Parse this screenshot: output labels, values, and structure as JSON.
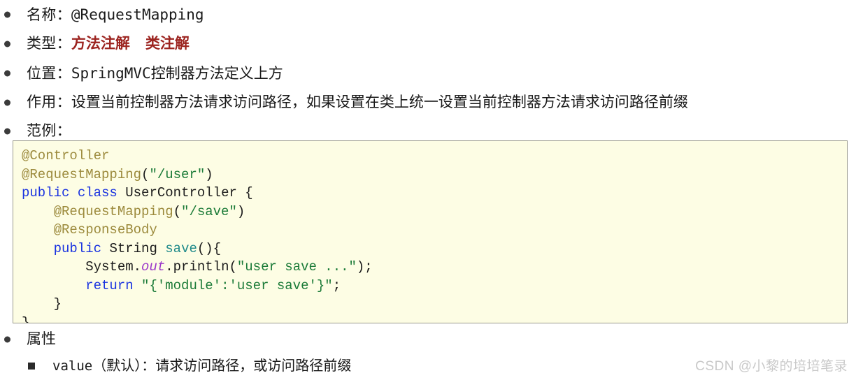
{
  "bullets": [
    {
      "label": "名称：",
      "value": "@RequestMapping",
      "style": "mono"
    },
    {
      "label": "类型：",
      "tags": [
        "方法注解",
        "类注解"
      ],
      "style": "tags"
    },
    {
      "label": "位置：",
      "value": "SpringMVC控制器方法定义上方",
      "style": "mixed"
    },
    {
      "label": "作用：",
      "value": "设置当前控制器方法请求访问路径，如果设置在类上统一设置当前控制器方法请求访问路径前缀",
      "style": "text"
    },
    {
      "label": "范例：",
      "value": "",
      "style": "text"
    }
  ],
  "code": {
    "lines": [
      [
        {
          "t": "@Controller",
          "c": "ann"
        }
      ],
      [
        {
          "t": "@RequestMapping",
          "c": "ann"
        },
        {
          "t": "(",
          "c": "plain"
        },
        {
          "t": "\"/user\"",
          "c": "str"
        },
        {
          "t": ")",
          "c": "plain"
        }
      ],
      [
        {
          "t": "public",
          "c": "kw"
        },
        {
          "t": " ",
          "c": "plain"
        },
        {
          "t": "class",
          "c": "kw"
        },
        {
          "t": " ",
          "c": "plain"
        },
        {
          "t": "UserController",
          "c": "type"
        },
        {
          "t": " {",
          "c": "plain"
        }
      ],
      [
        {
          "t": "    ",
          "c": "plain"
        },
        {
          "t": "@RequestMapping",
          "c": "ann"
        },
        {
          "t": "(",
          "c": "plain"
        },
        {
          "t": "\"/save\"",
          "c": "str"
        },
        {
          "t": ")",
          "c": "plain"
        }
      ],
      [
        {
          "t": "    ",
          "c": "plain"
        },
        {
          "t": "@ResponseBody",
          "c": "ann"
        }
      ],
      [
        {
          "t": "    ",
          "c": "plain"
        },
        {
          "t": "public",
          "c": "kw"
        },
        {
          "t": " ",
          "c": "plain"
        },
        {
          "t": "String",
          "c": "type"
        },
        {
          "t": " ",
          "c": "plain"
        },
        {
          "t": "save",
          "c": "fn"
        },
        {
          "t": "(){",
          "c": "plain"
        }
      ],
      [
        {
          "t": "        System.",
          "c": "plain"
        },
        {
          "t": "out",
          "c": "field"
        },
        {
          "t": ".println(",
          "c": "plain"
        },
        {
          "t": "\"user save ...\"",
          "c": "str"
        },
        {
          "t": ");",
          "c": "plain"
        }
      ],
      [
        {
          "t": "        ",
          "c": "plain"
        },
        {
          "t": "return",
          "c": "kw"
        },
        {
          "t": " ",
          "c": "plain"
        },
        {
          "t": "\"{'module':'user save'}\"",
          "c": "str"
        },
        {
          "t": ";",
          "c": "plain"
        }
      ],
      [
        {
          "t": "    }",
          "c": "plain"
        }
      ],
      [
        {
          "t": "}",
          "c": "plain"
        }
      ]
    ],
    "background_color": "#fdfde4",
    "border_color": "#9a9a8c",
    "annotation_color": "#9c8a3c",
    "keyword_color": "#1a33e0",
    "string_color": "#1a7a37",
    "method_color": "#1f8a8a",
    "field_color": "#9b37c9"
  },
  "attributes": {
    "heading": "属性",
    "items": [
      {
        "name": "value",
        "note": "（默认）：请求访问路径，或访问路径前缀"
      }
    ]
  },
  "watermark": "CSDN @小黎的培培笔录",
  "colors": {
    "accent_red": "#9c2420",
    "bullet": "#3b3b3b",
    "text": "#1a1a1a",
    "watermark": "#c9c9c9"
  }
}
